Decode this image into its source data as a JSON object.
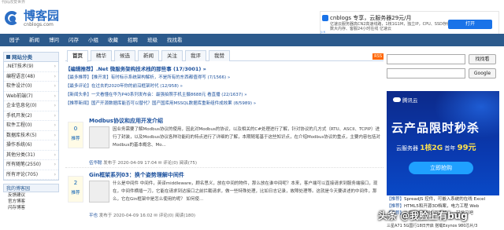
{
  "top_strip": "代码改变世界",
  "logo": {
    "name": "博客园",
    "domain": "cnblogs.com"
  },
  "top_ad": {
    "title": "cnblogs 专享，云服务器29元/月",
    "desc": "亿速云服务器高CN2高速线路，1核1G1M，独立IP，CPU、SSD存储器数大内存、客服24小时在线 亿速云",
    "button": "打开",
    "adchoice": "▷×"
  },
  "nav": [
    "园子",
    "新闻",
    "博问",
    "闪存",
    "小组",
    "收藏",
    "招聘",
    "班级",
    "找找看"
  ],
  "left": {
    "header": "网站分类",
    "items": [
      {
        "label": ".NET技术(9)"
      },
      {
        "label": "编程语言(48)"
      },
      {
        "label": "软件设计(0)"
      },
      {
        "label": "Web前端(7)"
      },
      {
        "label": "企业信息化(0)"
      },
      {
        "label": "手机开发(2)"
      },
      {
        "label": "软件工程(0)"
      },
      {
        "label": "数据库技术(5)"
      },
      {
        "label": "操作系统(6)"
      },
      {
        "label": "其他分类(31)"
      },
      {
        "label": "所有随笔(2550)"
      },
      {
        "label": "所有评论(705)"
      }
    ],
    "header2": "我的博客园",
    "sub": [
      "反馈建议",
      "官方博客",
      "闪存博客"
    ]
  },
  "tabs": [
    "首页",
    "精华",
    "候选",
    "新闻",
    "关注",
    "我评",
    "我赞"
  ],
  "rss": "RSS",
  "headlines": [
    "【编辑推荐】.Net 微服务架构技术栈的那些事 (17/3001) »",
    "【最多推荐】【推开发】有时标示系统架构解析，不是所有的东西都值得写 (7/1566) »",
    "【最多评论】在过去的2020年你的前沿框架时代 (12/958) »",
    "【新闻头条】一文看懂在华为P40系列发布会：最强拍照手机主摄8688元 看直播 (22/1637) »",
    "【推荐新闻】国产开源数据库能否可以替代？国产国库用MSSQL数据库重新组件成效果 (8/5989) »"
  ],
  "posts": [
    {
      "digg": "0",
      "digg_label": "推荐",
      "title": "Modbus协议和应用开发介绍",
      "body": "因业务需要了解Modbus协议的使用，因此对Modbus的协议，以及相关的C#处理进行了解，针对协议的几方式（RTU、ASCII、TCPIP）进行了封装，以及Modbus协议各种功能码的特点进行了详细的了解，本期随笔基于这些知识点，在介绍Modbus协议的重点，主要内容包括对Modbus的基本概念、Mo...",
      "author": "伍华聪",
      "time": "发布于 2020-04-09 17:04",
      "comments": "评论(0)",
      "reads": "阅读(75)"
    },
    {
      "digg": "2",
      "digg_label": "推荐",
      "title": "Gin框架系列03：换个姿势理解中间件",
      "body": "什么是中间件 中间件，英译middleware，顾名思义，放在中间的物件，那么放在谁中间呢？本来，客户端可以直接请求到服务端接口，现在，中间件横插一刀，它能在请求到达接口之前拦截请求，做一些特殊处理，比如日志记录，故障处理等。这就是今天要讲述的中间件，那么，它在Gin框架中是怎么使用的呢？ 如何使...",
      "author": "平也",
      "time": "发布于 2020-04-09 16:02",
      "comments": "评论(0)",
      "reads": "阅读(180)"
    }
  ],
  "search": {
    "btn1": "找找看",
    "btn2": "Google"
  },
  "side_ad": {
    "brand": "腾讯云",
    "headline": "云产品限时秒杀",
    "line_a": "云服务器",
    "line_b": "1核2G",
    "line_c": "首年",
    "price": "99元",
    "cta": "立即抢购"
  },
  "side_list": [
    {
      "tag": "【推荐】",
      "text": "SpreadJS 控件，可嵌入系统的在线 Excel"
    },
    {
      "tag": "【推荐】",
      "text": "HTML5和开源3D档案，电力工程 Web"
    },
    {
      "tag": "【推荐】",
      "text": "从零开始学到交互高级，一起学习吧"
    }
  ],
  "watermark": "头条 @我脸上有bug",
  "bottom_ad": "三星A71 5G国行18日开启 搭载Exynos 980芯片/3"
}
